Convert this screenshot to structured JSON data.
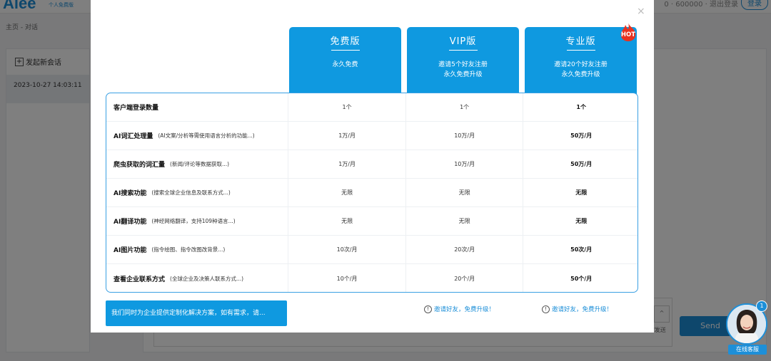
{
  "app": {
    "logo": "Alee",
    "logo_sub": "个人免费版",
    "topbar_right": "0 · 600000 · 退出登录",
    "topbar_button": "登录",
    "breadcrumb": "主页 - 对话",
    "new_chat": "发起新会话",
    "chat_history": [
      "2023-10-27 14:03:11"
    ],
    "input_hint": "/发送",
    "send_button": "Send"
  },
  "modal": {
    "close_label": "×",
    "plans": [
      {
        "name": "免费版",
        "desc": [
          "永久免费"
        ]
      },
      {
        "name": "VIP版",
        "desc": [
          "邀请5个好友注册",
          "永久免费升级"
        ]
      },
      {
        "name": "专业版",
        "desc": [
          "邀请20个好友注册",
          "永久免费升级"
        ],
        "badge": "HOT"
      }
    ],
    "features": [
      {
        "name": "客户端登录数量",
        "note": "",
        "values": [
          "1个",
          "1个",
          "1个"
        ]
      },
      {
        "name": "AI词汇处理量",
        "note": "(AI文案/分析等需使用语言分析的功能...)",
        "values": [
          "1万/月",
          "10万/月",
          "50万/月"
        ]
      },
      {
        "name": "爬虫获取的词汇量",
        "note": "(新闻/评论等数据获取...)",
        "values": [
          "1万/月",
          "10万/月",
          "50万/月"
        ]
      },
      {
        "name": "AI搜索功能",
        "note": "(搜索全球企业信息及联系方式...)",
        "values": [
          "无限",
          "无限",
          "无限"
        ]
      },
      {
        "name": "AI翻译功能",
        "note": "(神经网络翻译，支持109种语言...)",
        "values": [
          "无限",
          "无限",
          "无限"
        ]
      },
      {
        "name": "AI图片功能",
        "note": "(指令绘图、指令改图改背景...)",
        "values": [
          "10次/月",
          "20次/月",
          "50次/月"
        ]
      },
      {
        "name": "查看企业联系方式",
        "note": "(全球企业及决策人联系方式...)",
        "values": [
          "10个/月",
          "20个/月",
          "50个/月"
        ]
      }
    ],
    "custom_solution": "我们同时为企业提供定制化解决方案，如有需求，请...",
    "invite_vip": "邀请好友，免费升级！",
    "invite_pro": "邀请好友，免费升级！"
  },
  "support": {
    "label": "在线客服",
    "badge": "1"
  },
  "colors": {
    "accent": "#0f99e0",
    "hot": "#e8321f"
  }
}
